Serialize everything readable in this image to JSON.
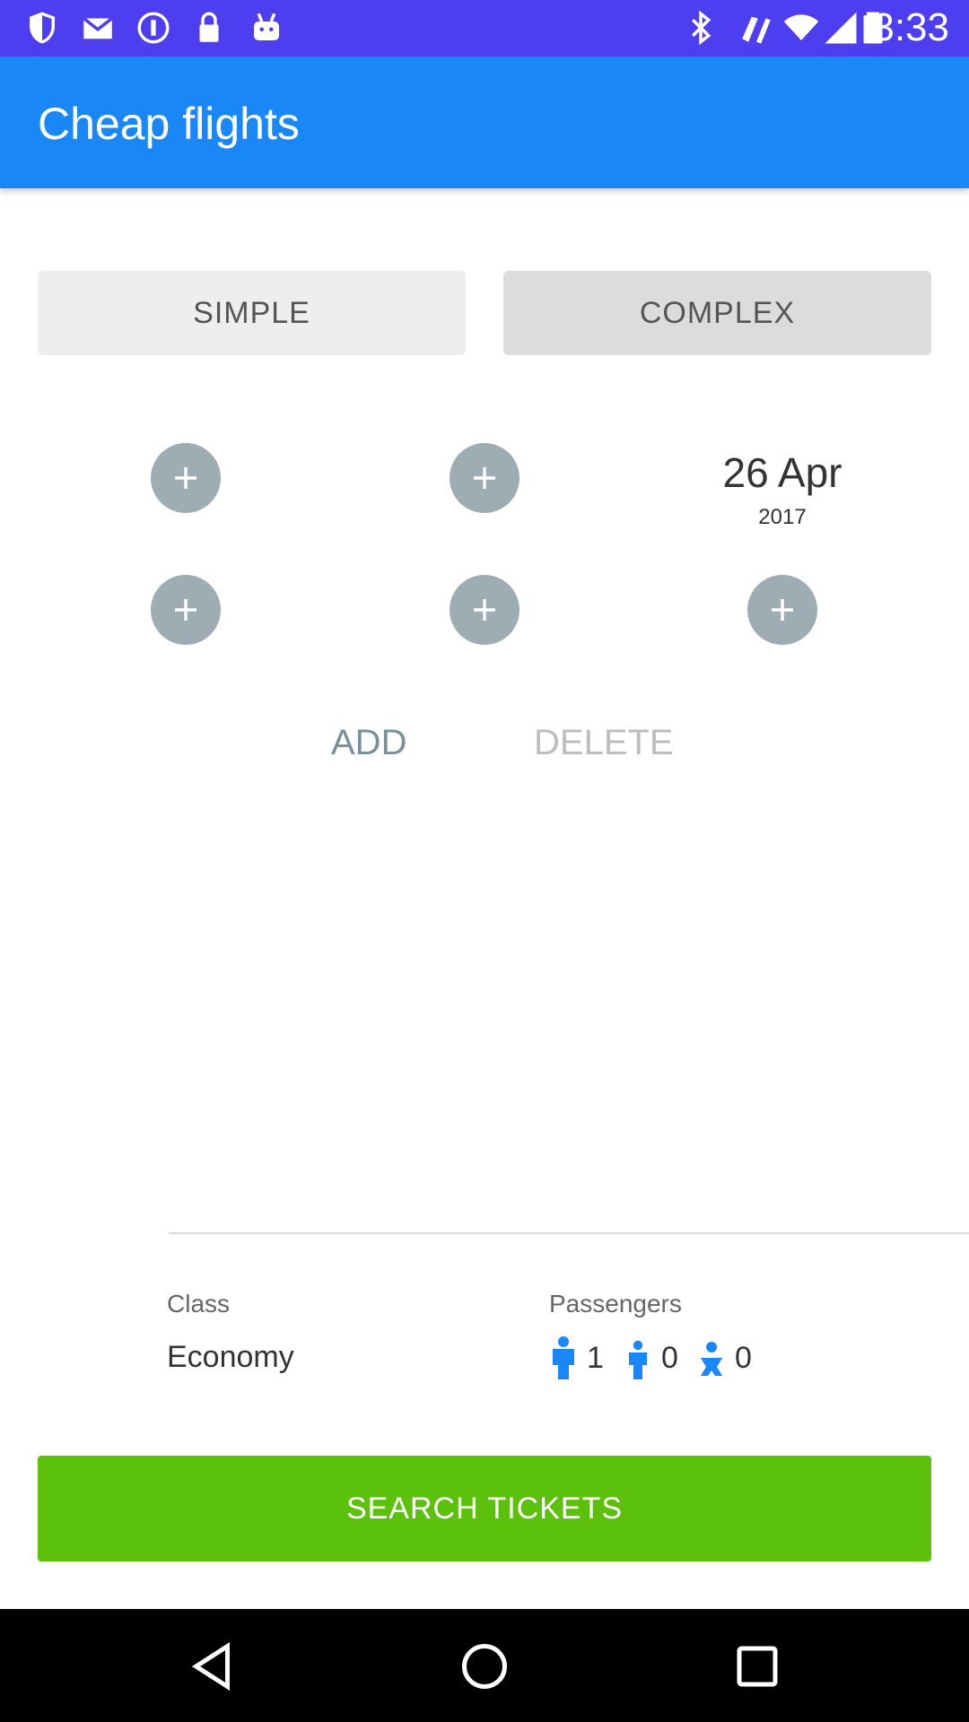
{
  "status_bar": {
    "time": "3:33",
    "icons": [
      "shield-icon",
      "mail-icon",
      "info-icon",
      "lock-icon",
      "android-icon",
      "bluetooth-icon",
      "vibrate-icon",
      "wifi-icon",
      "signal-icon",
      "battery-icon"
    ]
  },
  "app_bar": {
    "title": "Cheap flights"
  },
  "mode_toggle": {
    "simple": "SIMPLE",
    "complex": "COMPLEX"
  },
  "route": {
    "date_day": "26 Apr",
    "date_year": "2017"
  },
  "actions": {
    "add": "ADD",
    "delete": "DELETE"
  },
  "options": {
    "class_label": "Class",
    "class_value": "Economy",
    "passengers_label": "Passengers",
    "adults": "1",
    "children": "0",
    "infants": "0"
  },
  "search": {
    "label": "SEARCH TICKETS"
  },
  "colors": {
    "status_bar": "#4D3EF0",
    "app_bar": "#1A87F7",
    "plus_circle": "#9EACB4",
    "search_button": "#5BC10B",
    "passenger_icon": "#1A87F7",
    "add_text": "#78909C",
    "delete_text": "#BDBDBD"
  }
}
